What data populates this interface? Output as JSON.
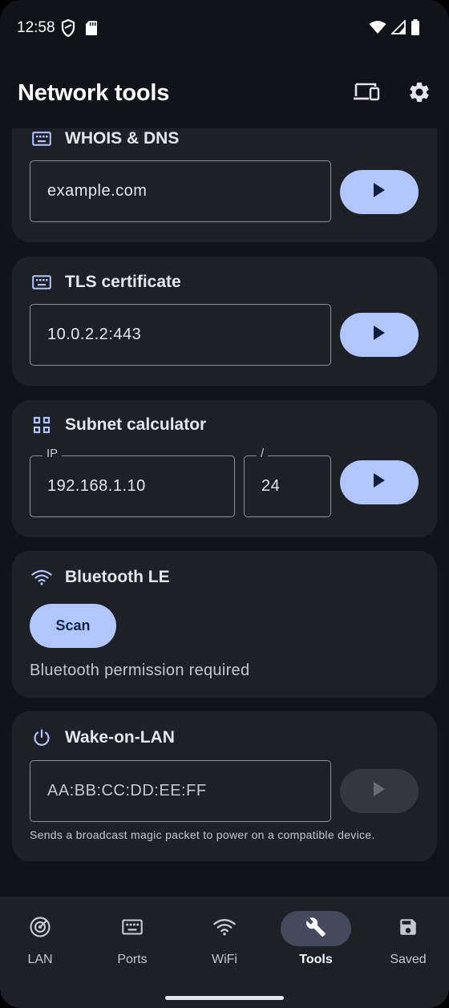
{
  "status_bar": {
    "time": "12:58"
  },
  "app_bar": {
    "title": "Network tools"
  },
  "cards": {
    "whois": {
      "title": "WHOIS & DNS",
      "input_value": "example.com"
    },
    "tls": {
      "title": "TLS certificate",
      "input_value": "10.0.2.2:443"
    },
    "subnet": {
      "title": "Subnet calculator",
      "ip_label": "IP",
      "ip_value": "192.168.1.10",
      "prefix_label": "/",
      "prefix_value": "24"
    },
    "bluetooth": {
      "title": "Bluetooth LE",
      "scan_label": "Scan",
      "status": "Bluetooth permission required"
    },
    "wol": {
      "title": "Wake-on-LAN",
      "input_placeholder": "AA:BB:CC:DD:EE:FF",
      "helper": "Sends a broadcast magic packet to power on a compatible device."
    }
  },
  "bottom_nav": {
    "items": [
      {
        "label": "LAN",
        "icon": "radar-icon"
      },
      {
        "label": "Ports",
        "icon": "keyboard-icon"
      },
      {
        "label": "WiFi",
        "icon": "wifi-icon"
      },
      {
        "label": "Tools",
        "icon": "wrench-icon",
        "active": true
      },
      {
        "label": "Saved",
        "icon": "save-icon"
      }
    ]
  },
  "colors": {
    "background": "#111318",
    "card": "#1d2026",
    "accent": "#b3c5ff",
    "active_pill": "#444a5c"
  }
}
